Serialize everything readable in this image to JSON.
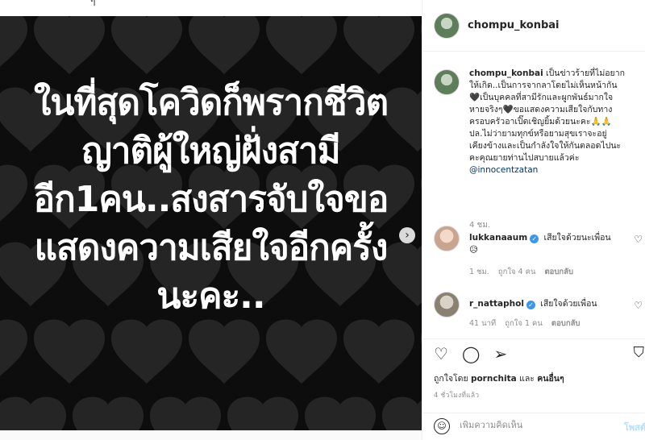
{
  "top_fragment": "ๆ",
  "post": {
    "image_text_lines": [
      "ในที่สุดโควิดก็พรากชีวิต",
      "ญาติผู้ใหญ่ฝั่งสามี",
      "อีก1คน..สงสารจับใจขอ",
      "แสดงความเสียใจอีกครั้ง",
      "นะคะ.."
    ],
    "next_icon": "chevron-right-icon",
    "next_glyph": "›"
  },
  "header": {
    "username": "chompu_konbai"
  },
  "caption": {
    "username": "chompu_konbai",
    "lines": [
      "เป็นข่าวร้ายที่ไม่อยาก",
      "ให้เกิด..เป็นการจากลาโดยไม่เห็นหน้ากัน",
      "🖤เป็นบุคคลที่สามีรักและผูกพันธ์มากใจ",
      "หายจริงๆ🖤ขอแสดงความเสียใจกับทาง",
      "ครอบครัวอาเปิ๊ดเชิญยิ้มด้วยนะคะ🙏🙏",
      "ปล.ไม่ว่ายามทุกข์หรือยามสุขเราจะอยู่",
      "เคียงข้างและเป็นกำลังใจให้กันตลอดไปนะ",
      "คะคุณยายท่านไปสบายแล้วค่ะ"
    ],
    "mention": "@innocentzatan",
    "time": "4 ชม."
  },
  "comments": [
    {
      "username": "lukkanaaum",
      "text": "เสียใจด้วยนะเพื่อน",
      "text2": "😥",
      "time": "1 ชม.",
      "likes": "ถูกใจ 4 คน",
      "reply": "ตอบกลับ"
    },
    {
      "username": "r_nattaphol",
      "text": "เสียใจด้วยเพื่อน",
      "text2": "",
      "time": "41 นาที",
      "likes": "ถูกใจ 1 คน",
      "reply": "ตอบกลับ"
    }
  ],
  "actions": {
    "like_icon": "heart-icon",
    "comment_icon": "comment-icon",
    "share_icon": "share-icon",
    "save_icon": "bookmark-icon",
    "liked_by_prefix": "ถูกใจโดย",
    "liked_by_user": "pornchita",
    "liked_by_and": "และ",
    "liked_by_others": "คนอื่นๆ",
    "posted_time": "4 ชั่วโมงที่แล้ว"
  },
  "add_comment": {
    "placeholder": "เพิ่มความคิดเห็น",
    "post_label": "โพสต์",
    "emoji_icon": "emoji-icon"
  },
  "colors": {
    "media_bg": "#0d0d0d",
    "heart_gray": "#3a3a3a",
    "link": "#00376b",
    "verified": "#3897f0",
    "post_disabled": "#b2dffc"
  }
}
